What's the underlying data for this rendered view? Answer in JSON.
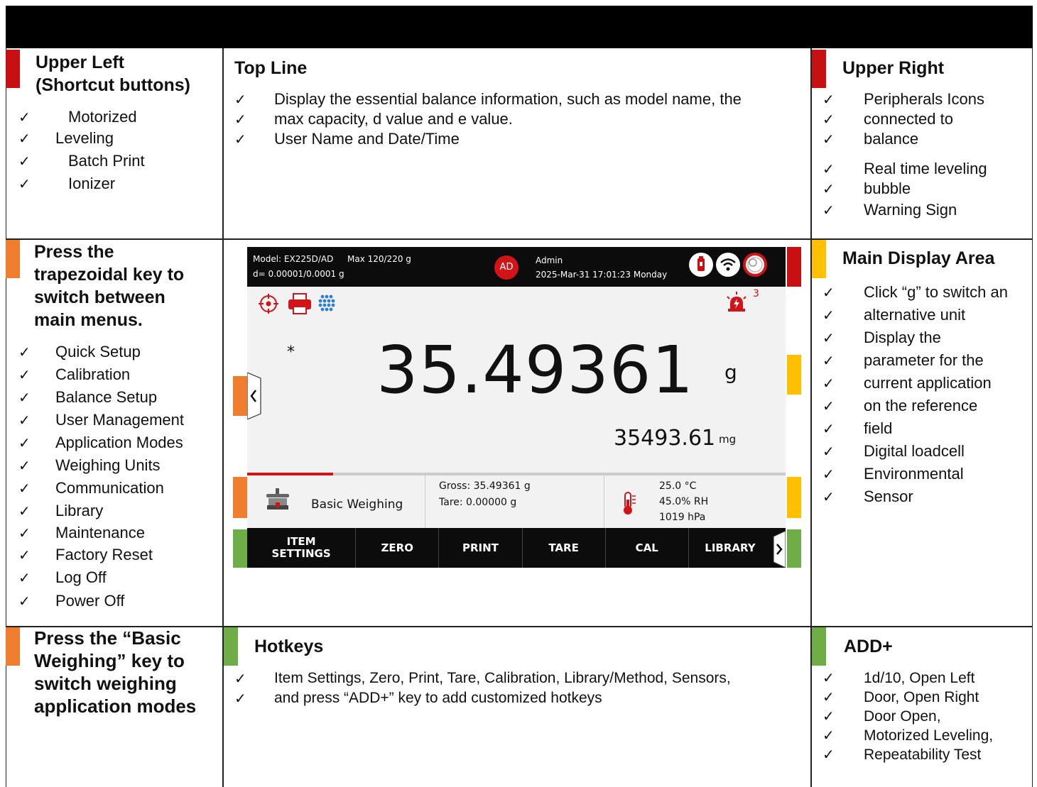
{
  "upper_left": {
    "heading": [
      "Upper Left",
      "(Shortcut buttons)"
    ],
    "items": [
      "Motorized",
      "Leveling",
      "Batch Print",
      "Ionizer"
    ]
  },
  "top_line": {
    "heading": "Top Line",
    "items": [
      "Display the essential balance information, such as model name, the",
      "max capacity, d value and e value.",
      "User Name and Date/Time"
    ]
  },
  "upper_right": {
    "heading": "Upper Right",
    "items": [
      "Peripherals Icons",
      "connected to",
      "balance",
      "Real time leveling",
      "bubble",
      "Warning Sign"
    ]
  },
  "trapezoidal": {
    "heading": [
      "Press the",
      "trapezoidal key to",
      "switch between",
      "main menus."
    ],
    "items": [
      "Quick Setup",
      "Calibration",
      "Balance Setup",
      "User Management",
      "Application Modes",
      "Weighing Units",
      "Communication",
      "Library",
      "Maintenance",
      "Factory Reset",
      "Log Off",
      "Power Off"
    ]
  },
  "main_display": {
    "heading": "Main Display Area",
    "items": [
      "Click “g” to switch an",
      "alternative unit",
      "Display the",
      "parameter for the",
      "current application",
      "on the reference",
      "field",
      "Digital loadcell",
      "Environmental",
      "Sensor"
    ]
  },
  "basic_weighing": {
    "heading": [
      "Press the “Basic",
      "Weighing” key to",
      "switch weighing",
      "application modes"
    ]
  },
  "hotkeys_section": {
    "heading": "Hotkeys",
    "items": [
      "Item Settings, Zero, Print, Tare, Calibration, Library/Method, Sensors,",
      "and press “ADD+” key to add customized hotkeys"
    ]
  },
  "add_section": {
    "heading": "ADD+",
    "items": [
      "1d/10, Open Left",
      "Door, Open Right",
      "Door Open,",
      "Motorized Leveling,",
      "Repeatability Test"
    ]
  },
  "screen": {
    "model": "Model: EX225D/AD",
    "max": "Max 120/220 g",
    "d_value": "d= 0.00001/0.0001 g",
    "user_badge": "AD",
    "user": "Admin",
    "datetime": "2025-Mar-31 17:01:23 Monday",
    "warning_count": "3",
    "asterisk": "*",
    "main_value": "35.49361",
    "main_unit": "g",
    "secondary_value": "35493.61",
    "secondary_unit": "mg",
    "app_mode": "Basic Weighing",
    "gross": "Gross: 35.49361 g",
    "tare": "Tare: 0.00000 g",
    "temperature": "25.0 °C",
    "humidity": "45.0% RH",
    "pressure": "1019 hPa",
    "progress": 0.16,
    "hotkeys": [
      "ITEM SETTINGS",
      "ZERO",
      "PRINT",
      "TARE",
      "CAL",
      "LIBRARY"
    ]
  },
  "colors": {
    "red": "#c80f12",
    "orange": "#ee7d30",
    "yellow": "#ffc000",
    "green": "#6fad46"
  }
}
